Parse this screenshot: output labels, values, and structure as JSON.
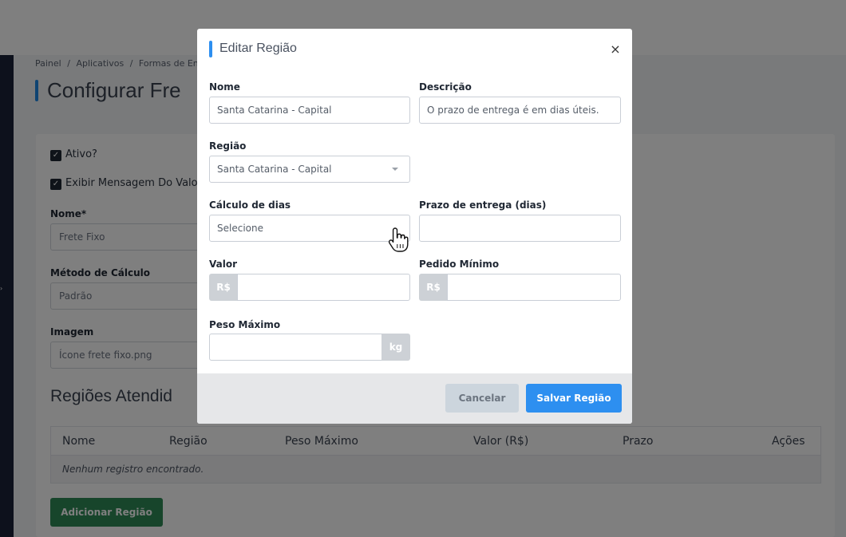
{
  "breadcrumb": [
    "Painel",
    "/",
    "Aplicativos",
    "/",
    "Formas de Env"
  ],
  "page": {
    "title": "Configurar Fre",
    "checkbox_active": "Ativo?",
    "checkbox_show_message": "Exibir Mensagem Do Valor",
    "name_label": "Nome*",
    "name_value": "Frete Fixo",
    "method_label": "Método de Cálculo",
    "method_value": "Padrão",
    "image_label": "Imagem",
    "image_value": "Ícone frete fixo.png",
    "regions_title": "Regiões Atendid",
    "table": {
      "columns": [
        "Nome",
        "Região",
        "Peso Máximo",
        "Valor (R$)",
        "Prazo",
        "Ações"
      ],
      "empty_message": "Nenhum registro encontrado."
    },
    "add_region_button": "Adicionar Região"
  },
  "modal": {
    "title": "Editar Região",
    "close": "×",
    "fields": {
      "nome": {
        "label": "Nome",
        "value": "Santa Catarina - Capital"
      },
      "descricao": {
        "label": "Descrição",
        "value": "O prazo de entrega é em dias úteis."
      },
      "regiao": {
        "label": "Região",
        "value": "Santa Catarina - Capital"
      },
      "calculo_dias": {
        "label": "Cálculo de dias",
        "value": "Selecione"
      },
      "prazo": {
        "label": "Prazo de entrega (dias)",
        "value": ""
      },
      "valor": {
        "label": "Valor",
        "prefix": "R$",
        "value": ""
      },
      "pedido_minimo": {
        "label": "Pedido Mínimo",
        "prefix": "R$",
        "value": ""
      },
      "peso_maximo": {
        "label": "Peso Máximo",
        "suffix": "kg",
        "value": ""
      }
    },
    "cancel_button": "Cancelar",
    "save_button": "Salvar Região"
  },
  "colors": {
    "primary": "#2d8ff0",
    "success": "#2e8b57",
    "sidebar": "#1b2338"
  },
  "icons": {
    "close": "close-icon",
    "cursor": "hand-pointer-icon",
    "checkbox": "checkbox-checked-icon"
  }
}
